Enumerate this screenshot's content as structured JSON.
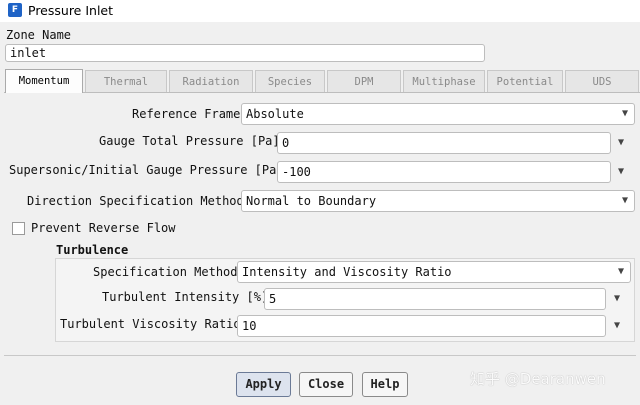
{
  "window": {
    "title": "Pressure Inlet",
    "icon": "fluent-app-icon"
  },
  "zone": {
    "label": "Zone Name",
    "value": "inlet"
  },
  "tabs": [
    {
      "label": "Momentum",
      "active": true
    },
    {
      "label": "Thermal",
      "active": false
    },
    {
      "label": "Radiation",
      "active": false
    },
    {
      "label": "Species",
      "active": false
    },
    {
      "label": "DPM",
      "active": false
    },
    {
      "label": "Multiphase",
      "active": false
    },
    {
      "label": "Potential",
      "active": false
    },
    {
      "label": "UDS",
      "active": false
    }
  ],
  "fields": {
    "reference_frame": {
      "label": "Reference Frame",
      "value": "Absolute"
    },
    "gauge_total_pressure": {
      "label": "Gauge Total Pressure [Pa]",
      "value": "0"
    },
    "supersonic_pressure": {
      "label": "Supersonic/Initial Gauge Pressure [Pa]",
      "value": "-100"
    },
    "direction_method": {
      "label": "Direction Specification Method",
      "value": "Normal to Boundary"
    },
    "prevent_reverse": {
      "label": "Prevent Reverse Flow",
      "checked": false
    }
  },
  "turbulence": {
    "heading": "Turbulence",
    "spec_method": {
      "label": "Specification Method",
      "value": "Intensity and Viscosity Ratio"
    },
    "intensity": {
      "label": "Turbulent Intensity [%]",
      "value": "5"
    },
    "viscosity_ratio": {
      "label": "Turbulent Viscosity Ratio",
      "value": "10"
    }
  },
  "buttons": {
    "apply": "Apply",
    "close": "Close",
    "help": "Help"
  },
  "watermark": "知乎 @Dearanwen",
  "colors": {
    "app_icon": "#1f63c6",
    "background": "#f0f0f0"
  }
}
